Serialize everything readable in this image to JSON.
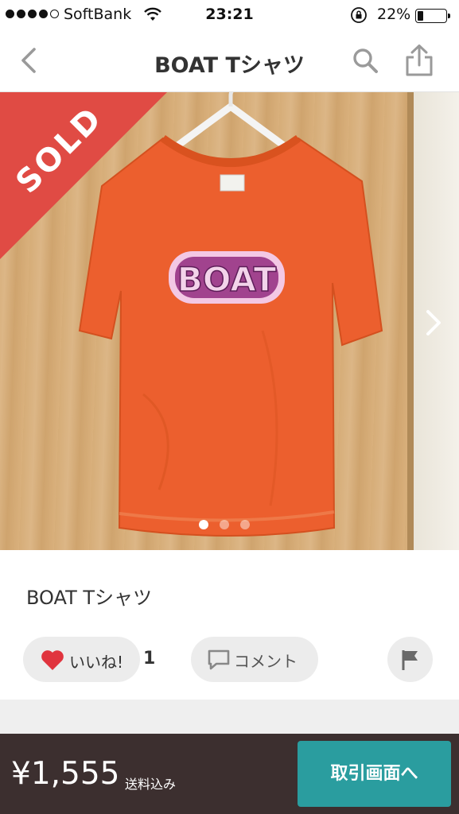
{
  "status_bar": {
    "carrier": "SoftBank",
    "time": "23:21",
    "battery_percent_text": "22%",
    "battery_level": 0.22,
    "signal_bars": 4,
    "signal_bars_max": 5
  },
  "nav": {
    "title": "BOAT Tシャツ",
    "icons": {
      "back": "chevron-left-icon",
      "search": "search-icon",
      "share": "share-icon"
    }
  },
  "photo": {
    "sold_label": "SOLD",
    "shirt_print": "BOAT",
    "page_count": 3,
    "current_page": 1
  },
  "item": {
    "name": "BOAT Tシャツ"
  },
  "actions": {
    "like_label": "いいね!",
    "like_count": "1",
    "comment_label": "コメント",
    "report_icon": "flag-icon"
  },
  "footer": {
    "price": "¥1,555",
    "shipping": "送料込み",
    "trade_button": "取引画面へ"
  },
  "colors": {
    "sold_banner": "#e04b44",
    "like_heart": "#e0343e",
    "trade_button": "#2a9d9f",
    "bottom_bar": "#3c2f2f",
    "shirt": "#ec5f2e"
  }
}
